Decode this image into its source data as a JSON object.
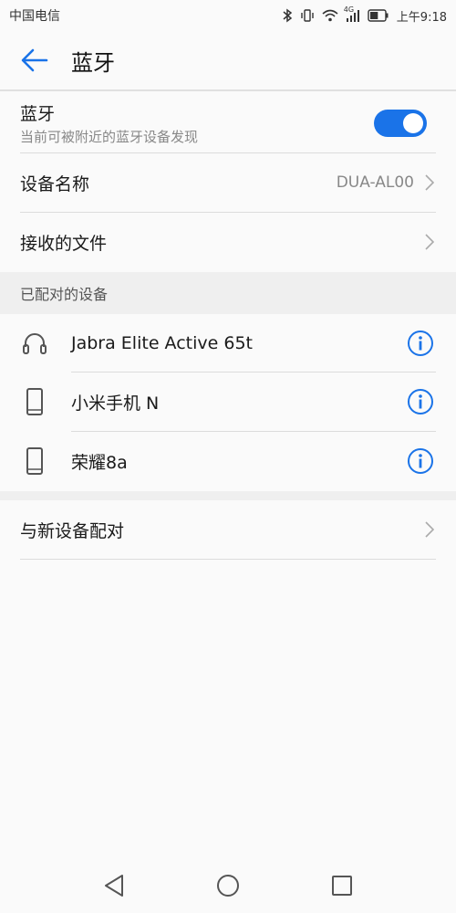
{
  "status_bar": {
    "carrier": "中国电信",
    "network": "4G",
    "time": "上午9:18",
    "battery_level": 0.55
  },
  "header": {
    "title": "蓝牙",
    "back_icon": "back-arrow-icon"
  },
  "bluetooth": {
    "label": "蓝牙",
    "sublabel": "当前可被附近的蓝牙设备发现",
    "enabled": true
  },
  "device_name": {
    "label": "设备名称",
    "value": "DUA-AL00"
  },
  "received_files": {
    "label": "接收的文件"
  },
  "paired_section": {
    "header": "已配对的设备",
    "devices": [
      {
        "name": "Jabra Elite Active 65t",
        "icon": "headset-icon"
      },
      {
        "name": "小米手机 N",
        "icon": "phone-icon"
      },
      {
        "name": "荣耀8a",
        "icon": "phone-icon"
      }
    ]
  },
  "pair_new": {
    "label": "与新设备配对"
  },
  "colors": {
    "accent": "#1a73e8",
    "background": "#fafafa",
    "section_bg": "#efefef"
  }
}
